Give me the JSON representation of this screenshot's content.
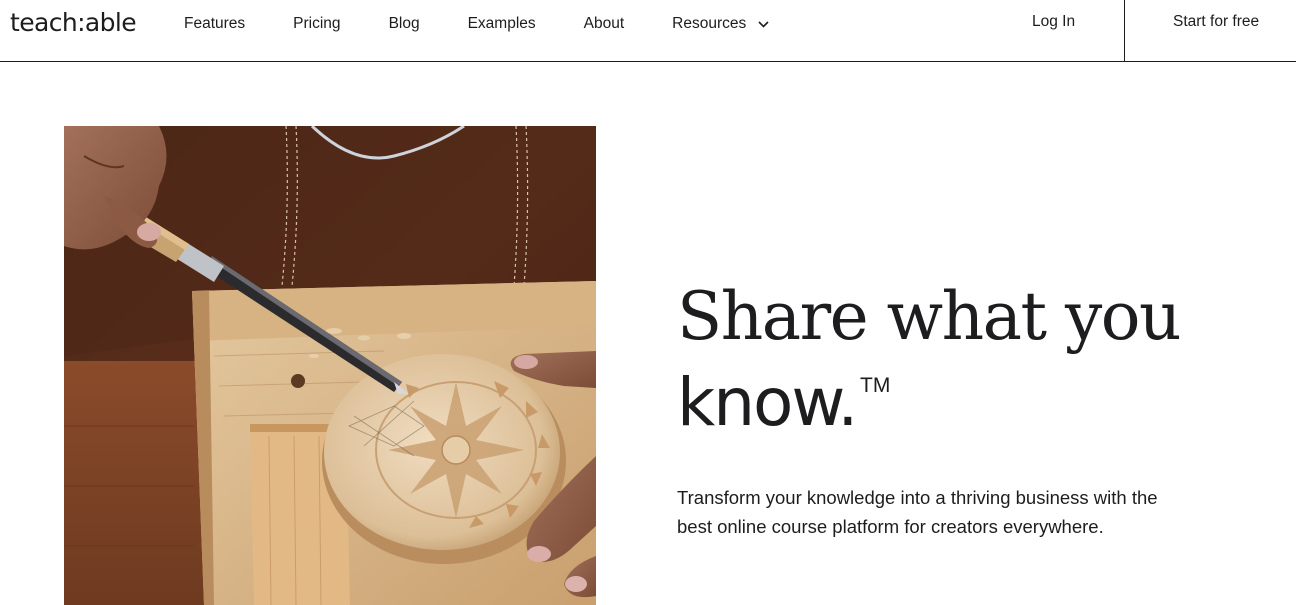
{
  "brand": {
    "logo_text": "teach:able"
  },
  "nav": {
    "items": [
      {
        "label": "Features"
      },
      {
        "label": "Pricing"
      },
      {
        "label": "Blog"
      },
      {
        "label": "Examples"
      },
      {
        "label": "About"
      },
      {
        "label": "Resources",
        "icon": "chevron-down-icon"
      }
    ]
  },
  "header_actions": {
    "login_label": "Log In",
    "start_label": "Start for free"
  },
  "hero": {
    "headline_line1": "Share what you",
    "headline_line2": "know.",
    "trademark": "TM",
    "subtext": "Transform your knowledge into a thriving business with the best online course platform for creators everywhere.",
    "image_description_icon": "wood-carving-photo"
  },
  "colors": {
    "text": "#1d1d1f",
    "background": "#ffffff",
    "divider": "#1d1d1f"
  }
}
